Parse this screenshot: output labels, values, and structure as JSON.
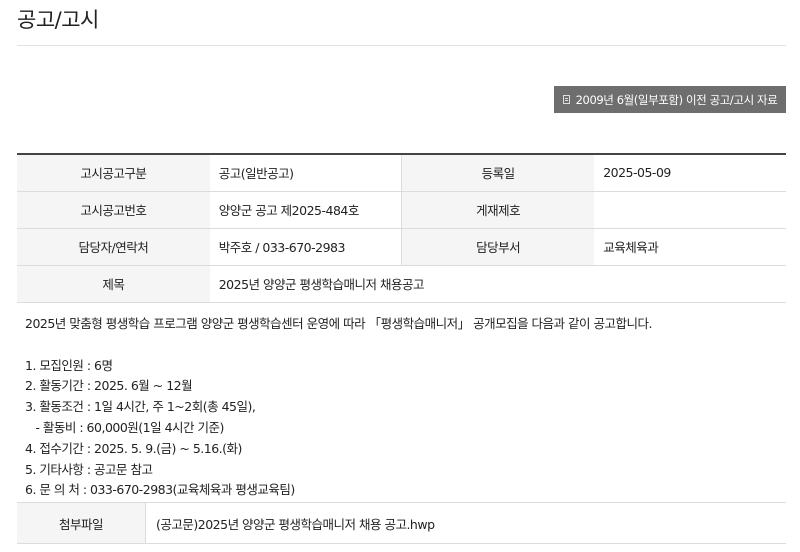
{
  "page": {
    "title": "공고/고시"
  },
  "archive_button": {
    "label": "2009년 6월(일부포함) 이전 공고/고시 자료",
    "icon": "document-icon"
  },
  "info": {
    "category_label": "고시공고구분",
    "category_value": "공고(일반공고)",
    "reg_date_label": "등록일",
    "reg_date_value": "2025-05-09",
    "notice_no_label": "고시공고번호",
    "notice_no_value": "양양군 공고 제2025-484호",
    "publish_no_label": "게재제호",
    "publish_no_value": "",
    "contact_label": "담당자/연락처",
    "contact_value": "박주호 / 033-670-2983",
    "dept_label": "담당부서",
    "dept_value": "교육체육과",
    "subject_label": "제목",
    "subject_value": "2025년 양양군 평생학습매니저 채용공고"
  },
  "body": {
    "intro": "2025년 맞춤형 평생학습 프로그램 양양군 평생학습센터 운영에 따라 「평생학습매니저」 공개모집을 다음과 같이 공고합니다.",
    "lines": [
      "1. 모집인원 : 6명",
      "2. 활동기간 : 2025. 6월 ~ 12월",
      "3. 활동조건 : 1일 4시간, 주 1~2회(총 45일),",
      "   - 활동비 : 60,000원(1일 4시간 기준)",
      "4. 접수기간 : 2025. 5. 9.(금) ~ 5.16.(화)",
      "5. 기타사항 : 공고문 참고",
      "6. 문 의 처 : 033-670-2983(교육체육과 평생교육팀)"
    ]
  },
  "attachment": {
    "label": "첨부파일",
    "file_name": "(공고문)2025년 양양군 평생학습매니저 채용 공고.hwp"
  }
}
